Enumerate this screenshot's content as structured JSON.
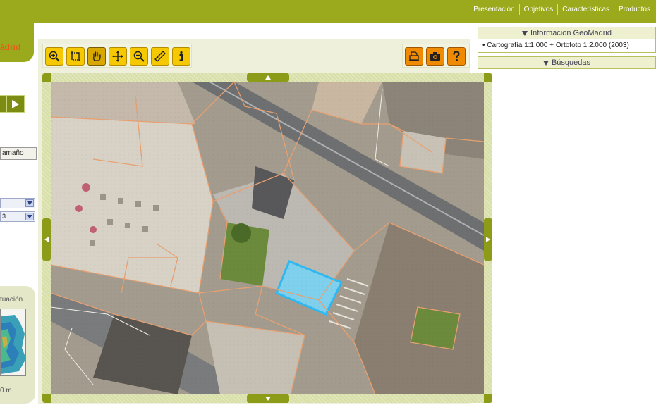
{
  "topnav": {
    "items": [
      {
        "label": "Presentación"
      },
      {
        "label": "Objetivos"
      },
      {
        "label": "Características"
      },
      {
        "label": "Productos"
      }
    ]
  },
  "logo": {
    "text": "ádrid"
  },
  "toolbar": {
    "tools": [
      {
        "icon": "zoom-in-icon"
      },
      {
        "icon": "zoom-box-icon"
      },
      {
        "icon": "pan-hand-icon",
        "active": true
      },
      {
        "icon": "move-arrows-icon"
      },
      {
        "icon": "zoom-out-icon"
      },
      {
        "icon": "measure-ruler-icon"
      },
      {
        "icon": "info-icon",
        "label": "i"
      }
    ],
    "right_tools": [
      {
        "icon": "print-icon"
      },
      {
        "icon": "camera-icon"
      },
      {
        "icon": "help-icon",
        "label": "?"
      }
    ]
  },
  "side_panel": {
    "info_header": "Informacion GeoMadrid",
    "info_item": "• Cartografía 1:1.000 + Ortofoto 1:2.000 (2003)",
    "search_header": "Búsquedas"
  },
  "left_panel": {
    "size_button": "amaño",
    "select_1": "",
    "select_2": "3",
    "situation_title": "tuación",
    "scale_text": "0 m"
  },
  "colors": {
    "brand_green": "#9aaa1c",
    "logo_orange": "#e85a1a",
    "tool_yellow": "#f5c800",
    "tool_orange": "#f08a00",
    "parcel_line": "#e8a070",
    "pool_blue": "#30b8f0"
  }
}
